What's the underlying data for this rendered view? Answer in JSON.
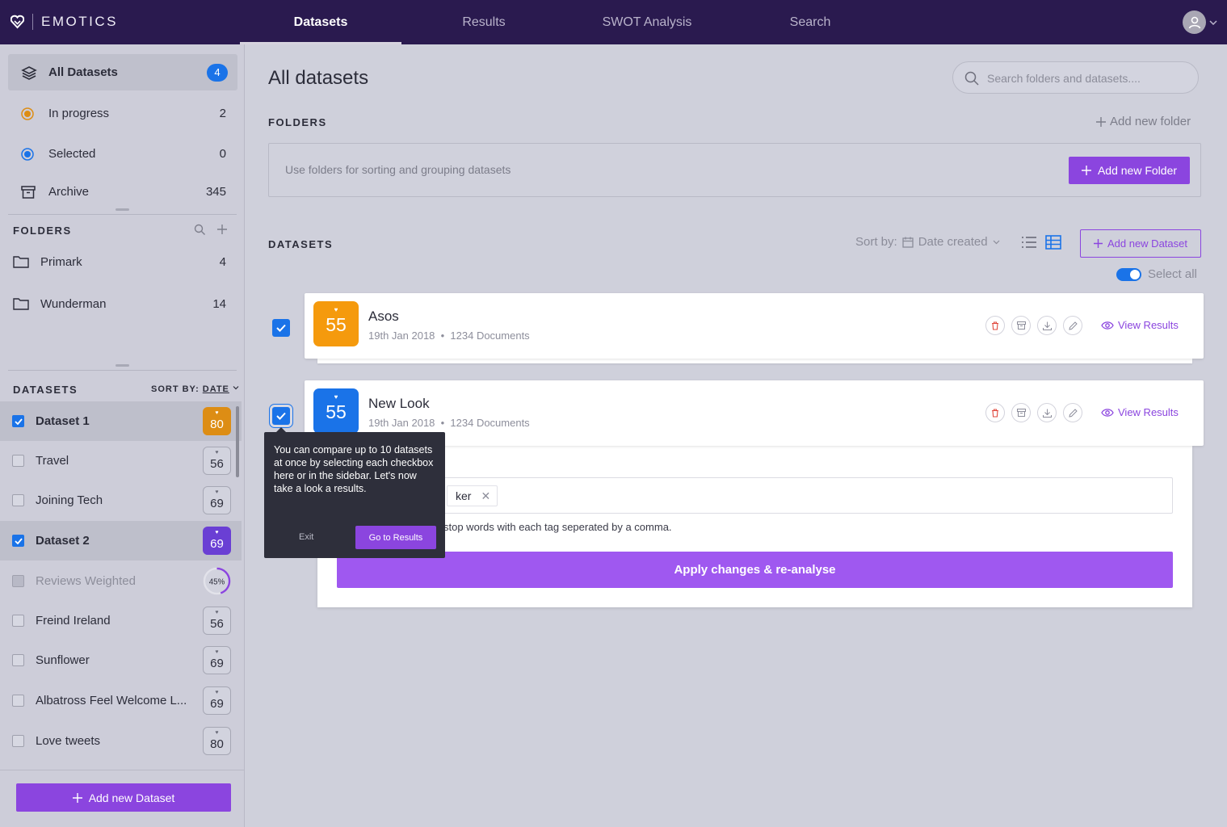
{
  "app": {
    "name": "EMOTICS"
  },
  "nav": {
    "tabs": [
      {
        "label": "Datasets",
        "active": true
      },
      {
        "label": "Results",
        "active": false
      },
      {
        "label": "SWOT Analysis",
        "active": false
      },
      {
        "label": "Search",
        "active": false
      }
    ]
  },
  "sidebar": {
    "status_items": [
      {
        "label": "All Datasets",
        "count": "4",
        "icon": "layers-icon",
        "active": true
      },
      {
        "label": "In progress",
        "count": "2",
        "icon": "radio-orange-icon"
      },
      {
        "label": "Selected",
        "count": "0",
        "icon": "radio-blue-icon"
      },
      {
        "label": "Archive",
        "count": "345",
        "icon": "archive-box-icon"
      }
    ],
    "folders_title": "FOLDERS",
    "folders": [
      {
        "label": "Primark",
        "count": "4"
      },
      {
        "label": "Wunderman",
        "count": "14"
      }
    ],
    "datasets_title": "DATASETS",
    "sort_label": "SORT BY:",
    "sort_value": "DATE",
    "datasets": [
      {
        "label": "Dataset 1",
        "score": "80",
        "checked": true,
        "style": "orange"
      },
      {
        "label": "Travel",
        "score": "56",
        "checked": false,
        "style": "plain"
      },
      {
        "label": "Joining Tech",
        "score": "69",
        "checked": false,
        "style": "plain"
      },
      {
        "label": "Dataset 2",
        "score": "69",
        "checked": true,
        "style": "purple"
      },
      {
        "label": "Reviews Weighted",
        "score": "45%",
        "checked": false,
        "style": "progress",
        "progress": 0.45
      },
      {
        "label": "Freind Ireland",
        "score": "56",
        "checked": false,
        "style": "plain"
      },
      {
        "label": "Sunflower",
        "score": "69",
        "checked": false,
        "style": "plain"
      },
      {
        "label": "Albatross Feel Welcome L...",
        "score": "69",
        "checked": false,
        "style": "plain"
      },
      {
        "label": "Love tweets",
        "score": "80",
        "checked": false,
        "style": "plain"
      }
    ],
    "add_dataset_label": "Add new Dataset"
  },
  "main": {
    "title": "All datasets",
    "search_placeholder": "Search folders and datasets....",
    "folders_label": "FOLDERS",
    "add_folder_link": "Add new folder",
    "folders_hint": "Use folders for sorting and grouping datasets",
    "add_folder_button": "Add new Folder",
    "datasets_label": "DATASETS",
    "sort_by_label": "Sort by:",
    "sort_by_value": "Date created",
    "add_dataset_button": "Add new Dataset",
    "select_all_label": "Select all",
    "cards": [
      {
        "name": "Asos",
        "score": "55",
        "date": "19th Jan 2018",
        "docs": "1234 Documents",
        "color": "#f59a0d",
        "view_label": "View Results"
      },
      {
        "name": "New Look",
        "score": "55",
        "date": "19th Jan 2018",
        "docs": "1234 Documents",
        "color": "#1a73e8",
        "view_label": "View Results"
      }
    ],
    "edit": {
      "tag_partial": "ker",
      "hint_partial": "stop words with each tag seperated by a comma.",
      "apply_label": "Apply changes & re-analyse"
    }
  },
  "tooltip": {
    "text": "You can compare up to 10 datasets at once by selecting each checkbox here or in the sidebar. Let's now take a look a results.",
    "exit_label": "Exit",
    "go_label": "Go to Results"
  },
  "colors": {
    "accent": "#8b45df",
    "topbar": "#2a1a4f",
    "blue": "#1a73e8",
    "orange": "#dd8d14"
  }
}
